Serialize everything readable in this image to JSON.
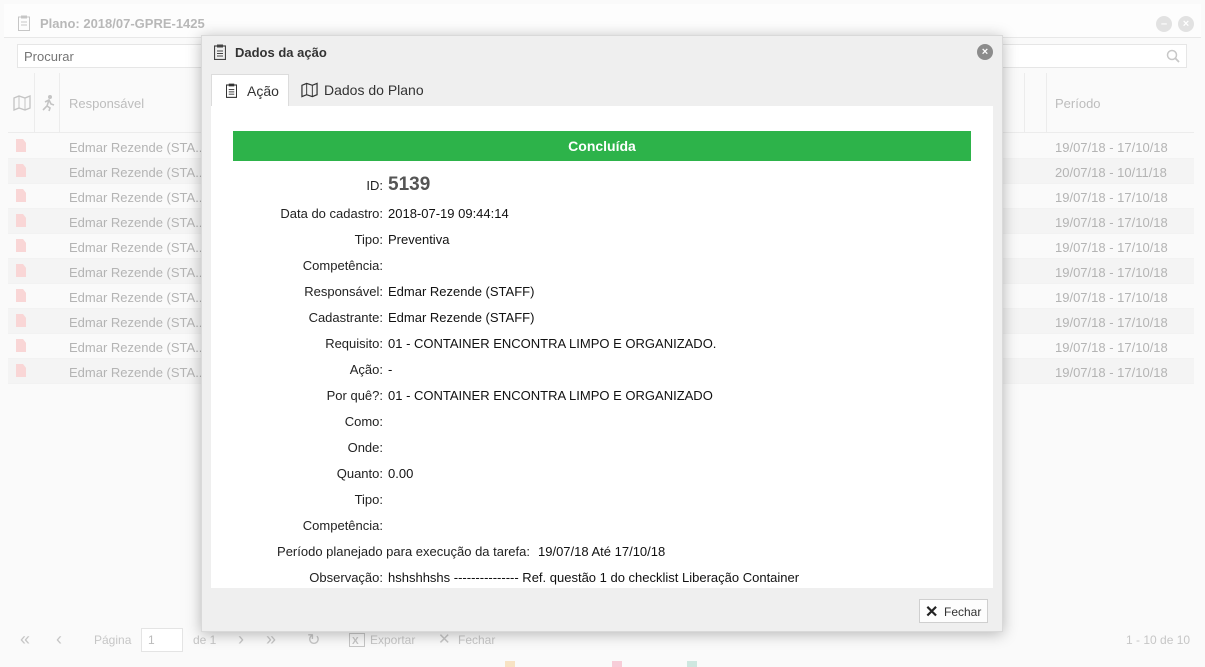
{
  "background": {
    "title": "Plano: 2018/07-GPRE-1425",
    "search_placeholder": "Procurar",
    "columns": {
      "responsavel": "Responsável",
      "periodo": "Período"
    },
    "rows": [
      {
        "responsavel": "Edmar Rezende (STA...",
        "periodo": "19/07/18 - 17/10/18"
      },
      {
        "responsavel": "Edmar Rezende (STA...",
        "periodo": "20/07/18 - 10/11/18"
      },
      {
        "responsavel": "Edmar Rezende (STA...",
        "periodo": "19/07/18 - 17/10/18"
      },
      {
        "responsavel": "Edmar Rezende (STA...",
        "periodo": "19/07/18 - 17/10/18"
      },
      {
        "responsavel": "Edmar Rezende (STA...",
        "periodo": "19/07/18 - 17/10/18"
      },
      {
        "responsavel": "Edmar Rezende (STA...",
        "periodo": "19/07/18 - 17/10/18"
      },
      {
        "responsavel": "Edmar Rezende (STA...",
        "periodo": "19/07/18 - 17/10/18"
      },
      {
        "responsavel": "Edmar Rezende (STA...",
        "periodo": "19/07/18 - 17/10/18"
      },
      {
        "responsavel": "Edmar Rezende (STA...",
        "periodo": "19/07/18 - 17/10/18"
      },
      {
        "responsavel": "Edmar Rezende (STA...",
        "periodo": "19/07/18 - 17/10/18"
      }
    ],
    "footer": {
      "page_label": "Página",
      "page_value": "1",
      "of_label": "de 1",
      "export_label": "Exportar",
      "close_label": "Fechar",
      "range_label": "1 - 10 de 10"
    }
  },
  "modal": {
    "title": "Dados da ação",
    "tabs": [
      {
        "label": "Ação",
        "icon": "clipboard-icon",
        "active": true
      },
      {
        "label": "Dados do Plano",
        "icon": "map-icon",
        "active": false
      }
    ],
    "status": "Concluída",
    "status_color": "#2db34a",
    "fields": {
      "id": {
        "label": "ID:",
        "value": "5139"
      },
      "data_cadastro": {
        "label": "Data do cadastro:",
        "value": "2018-07-19 09:44:14"
      },
      "tipo": {
        "label": "Tipo:",
        "value": "Preventiva"
      },
      "competencia": {
        "label": "Competência:",
        "value": ""
      },
      "responsavel": {
        "label": "Responsável:",
        "value": "Edmar Rezende (STAFF)"
      },
      "cadastrante": {
        "label": "Cadastrante:",
        "value": "Edmar Rezende (STAFF)"
      },
      "requisito": {
        "label": "Requisito:",
        "value": "01 - CONTAINER ENCONTRA LIMPO E ORGANIZADO."
      },
      "acao": {
        "label": "Ação:",
        "value": "-"
      },
      "por_que": {
        "label": "Por quê?:",
        "value": "01 - CONTAINER ENCONTRA LIMPO E ORGANIZADO"
      },
      "como": {
        "label": "Como:",
        "value": ""
      },
      "onde": {
        "label": "Onde:",
        "value": ""
      },
      "quanto": {
        "label": "Quanto:",
        "value": "0.00"
      },
      "tipo2": {
        "label": "Tipo:",
        "value": ""
      },
      "competencia2": {
        "label": "Competência:",
        "value": ""
      },
      "periodo": {
        "label": "Período planejado para execução da tarefa:",
        "value": "19/07/18 Até 17/10/18"
      },
      "observacao": {
        "label": "Observação:",
        "value": "hshshhshs --------------- Ref. questão 1 do checklist Liberação Container"
      }
    },
    "close_button": "Fechar"
  }
}
